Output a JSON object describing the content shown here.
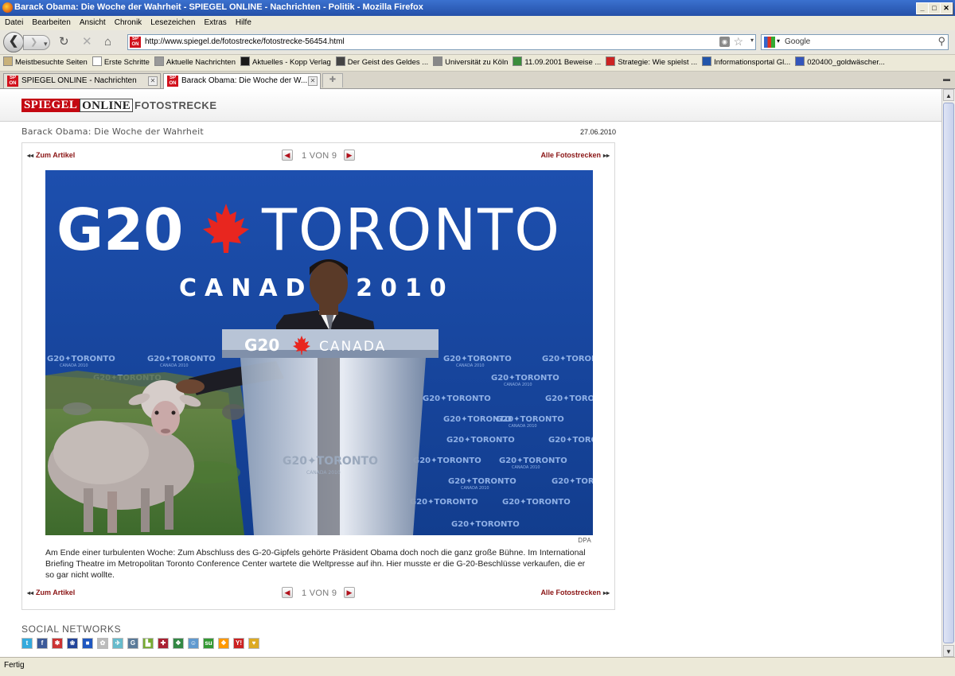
{
  "window": {
    "title": "Barack Obama: Die Woche der Wahrheit - SPIEGEL ONLINE - Nachrichten - Politik - Mozilla Firefox"
  },
  "menu": [
    "Datei",
    "Bearbeiten",
    "Ansicht",
    "Chronik",
    "Lesezeichen",
    "Extras",
    "Hilfe"
  ],
  "address": {
    "url": "http://www.spiegel.de/fotostrecke/fotostrecke-56454.html"
  },
  "search": {
    "placeholder": "Google"
  },
  "bookmarks": [
    {
      "label": "Meistbesuchte Seiten",
      "icon": "bookmark-icon",
      "color": "#c9b27a"
    },
    {
      "label": "Erste Schritte",
      "icon": "page-icon",
      "color": "#ffffff"
    },
    {
      "label": "Aktuelle Nachrichten",
      "icon": "rss-icon",
      "color": "#999999"
    },
    {
      "label": "Aktuelles - Kopp Verlag",
      "icon": "kopp-icon",
      "color": "#1a1a1a"
    },
    {
      "label": "Der Geist des Geldes ...",
      "icon": "camera-icon",
      "color": "#444444"
    },
    {
      "label": "Universität zu Köln",
      "icon": "globe-icon",
      "color": "#888888"
    },
    {
      "label": "11.09.2001 Beweise ...",
      "icon": "google-icon",
      "color": "#3b8d3b"
    },
    {
      "label": "Strategie: Wie spielst ...",
      "icon": "percent-icon",
      "color": "#cc2222"
    },
    {
      "label": "Informationsportal Gl...",
      "icon": "portal-icon",
      "color": "#2255aa"
    },
    {
      "label": "020400_goldwäscher...",
      "icon": "file-icon",
      "color": "#3355bb"
    }
  ],
  "tabs": [
    {
      "label": "SPIEGEL ONLINE - Nachrichten",
      "active": false
    },
    {
      "label": "Barack Obama: Die Woche der W...",
      "active": true
    }
  ],
  "site": {
    "logo_part1": "SPIEGEL",
    "logo_part2": "ONLINE",
    "section": "FOTOSTRECKE"
  },
  "gallery": {
    "title": "Barack Obama: Die Woche der Wahrheit",
    "date": "27.06.2010",
    "back_link": "Zum Artikel",
    "all_link": "Alle Fotostrecken",
    "page_text": "1 VON 9",
    "current_page": 1,
    "total_pages": 9,
    "photo": {
      "headline": "G20",
      "headline_city": "TORONTO",
      "subline": "CANADA 2010",
      "podium": "G20",
      "podium_country": "CANADA",
      "backdrop_text": "G20✦TORONTO",
      "backdrop_small": "CANADA 2010",
      "podium_front": "G20✦TORONTO",
      "podium_front_small": "CANADA 2010",
      "background_color": "#1b4ba5"
    },
    "credit": "DPA",
    "caption": "Am Ende einer turbulenten Woche: Zum Abschluss des G-20-Gipfels gehörte Präsident Obama doch noch die ganz große Bühne. Im International Briefing Theatre im Metropolitan Toronto Conference Center wartete die Weltpresse auf ihn. Hier musste er die G-20-Beschlüsse verkaufen, die er so gar nicht wollte."
  },
  "social": {
    "label": "SOCIAL NETWORKS",
    "icons": [
      {
        "name": "twitter-icon",
        "color": "#33aadd",
        "glyph": "t"
      },
      {
        "name": "facebook-icon",
        "color": "#3b5998",
        "glyph": "f"
      },
      {
        "name": "studivz-icon",
        "color": "#cc3333",
        "glyph": "✱"
      },
      {
        "name": "myspace-icon",
        "color": "#224499",
        "glyph": "❀"
      },
      {
        "name": "delicious-icon",
        "color": "#1f57c0",
        "glyph": "■"
      },
      {
        "name": "mrwong-icon",
        "color": "#bbbbbb",
        "glyph": "✿"
      },
      {
        "name": "webnews-icon",
        "color": "#66bbcc",
        "glyph": "✈"
      },
      {
        "name": "google-bookmark-icon",
        "color": "#5a7a99",
        "glyph": "G"
      },
      {
        "name": "yigg-icon",
        "color": "#77aa33",
        "glyph": "▙"
      },
      {
        "name": "linkarena-icon",
        "color": "#aa2233",
        "glyph": "✚"
      },
      {
        "name": "folkd-icon",
        "color": "#338844",
        "glyph": "❖"
      },
      {
        "name": "reddit-icon",
        "color": "#5f99cf",
        "glyph": "☺"
      },
      {
        "name": "stumbleupon-icon",
        "color": "#339933",
        "glyph": "su"
      },
      {
        "name": "windows-live-icon",
        "color": "#ff9900",
        "glyph": "❖"
      },
      {
        "name": "yahoo-icon",
        "color": "#cc2222",
        "glyph": "Y!"
      },
      {
        "name": "favorites-icon",
        "color": "#ddaa22",
        "glyph": "♥"
      }
    ]
  },
  "status": {
    "text": "Fertig"
  }
}
